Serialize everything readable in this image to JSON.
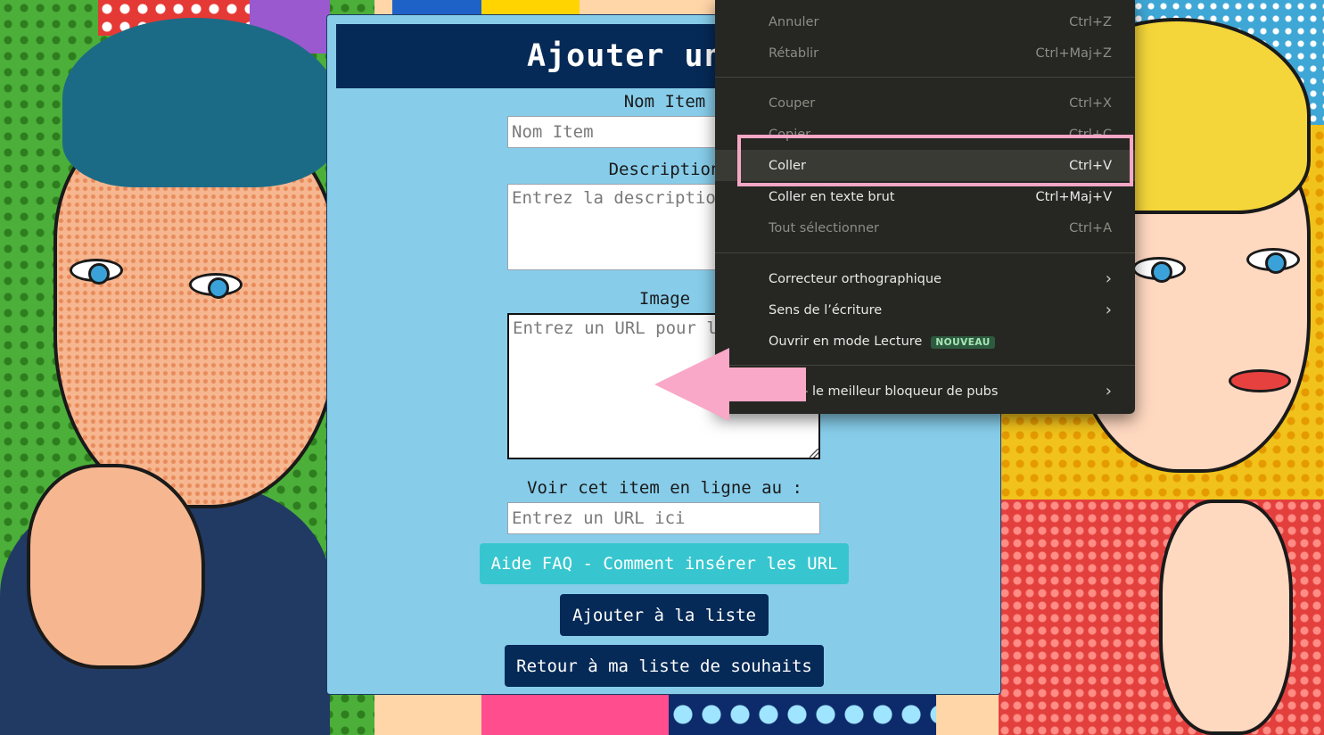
{
  "form": {
    "title": "Ajouter une su",
    "name_label": "Nom Item",
    "name_placeholder": "Nom Item",
    "description_label": "Description",
    "description_placeholder": "Entrez la description",
    "image_label": "Image",
    "image_placeholder": "Entrez un URL pour l'",
    "link_label": "Voir cet item en ligne au :",
    "link_placeholder": "Entrez un URL ici",
    "faq_button": "Aide FAQ - Comment insérer les URL",
    "add_button": "Ajouter à la liste",
    "back_button": "Retour à ma liste de souhaits"
  },
  "context_menu": {
    "items": [
      {
        "label": "Annuler",
        "shortcut": "Ctrl+Z",
        "state": "disabled"
      },
      {
        "label": "Rétablir",
        "shortcut": "Ctrl+Maj+Z",
        "state": "disabled"
      },
      {
        "label": "Couper",
        "shortcut": "Ctrl+X",
        "state": "disabled"
      },
      {
        "label": "Copier",
        "shortcut": "Ctrl+C",
        "state": "disabled"
      },
      {
        "label": "Coller",
        "shortcut": "Ctrl+V",
        "state": "hover"
      },
      {
        "label": "Coller en texte brut",
        "shortcut": "Ctrl+Maj+V",
        "state": "enabled"
      },
      {
        "label": "Tout sélectionner",
        "shortcut": "Ctrl+A",
        "state": "disabled"
      },
      {
        "label": "Correcteur orthographique",
        "submenu": true,
        "state": "enabled"
      },
      {
        "label": "Sens de l’écriture",
        "submenu": true,
        "state": "enabled"
      },
      {
        "label": "Ouvrir en mode Lecture",
        "badge": "NOUVEAU",
        "state": "enabled"
      },
      {
        "label": "ock — le meilleur bloqueur de pubs",
        "submenu": true,
        "state": "enabled"
      }
    ]
  },
  "annotations": {
    "highlight_color": "#f7a7c6",
    "arrow_color": "#f9a8c7"
  },
  "colors": {
    "panel_bg": "#87cdea",
    "header_bg": "#062a57",
    "faq_button_bg": "#37c6cf",
    "menu_bg": "#262622"
  }
}
